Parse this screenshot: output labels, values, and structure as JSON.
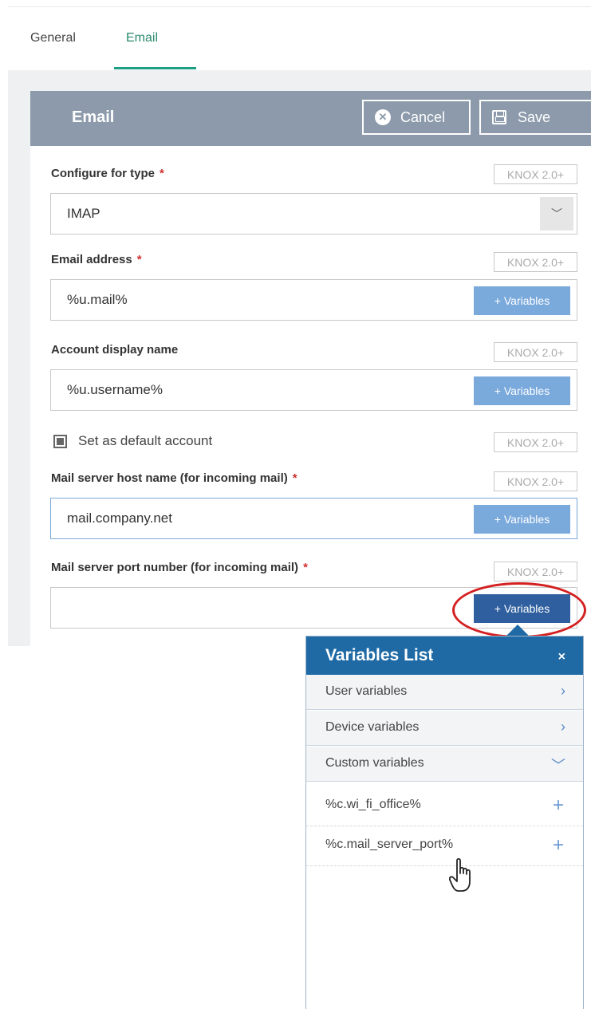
{
  "tabs": {
    "general": "General",
    "email": "Email"
  },
  "header": {
    "title": "Email",
    "cancel": "Cancel",
    "save": "Save"
  },
  "knox_badge": "KNOX 2.0+",
  "fields": {
    "configure_type": {
      "label": "Configure for type",
      "value": "IMAP"
    },
    "email_address": {
      "label": "Email address",
      "value": "%u.mail%"
    },
    "display_name": {
      "label": "Account display name",
      "value": "%u.username%"
    },
    "default_account": {
      "label": "Set as default account",
      "checked": true
    },
    "host_name": {
      "label": "Mail server host name (for incoming mail)",
      "value": "mail.company.net"
    },
    "port_number": {
      "label": "Mail server port number (for incoming mail)",
      "value": ""
    }
  },
  "required_mark": "*",
  "variables_button": "+ Variables",
  "variables_popup": {
    "title": "Variables List",
    "close": "×",
    "groups": [
      {
        "label": "User variables",
        "icon": "chevron-right-icon"
      },
      {
        "label": "Device variables",
        "icon": "chevron-right-icon"
      },
      {
        "label": "Custom variables",
        "icon": "chevron-down-icon"
      }
    ],
    "items": [
      {
        "label": "%c.wi_fi_office%"
      },
      {
        "label": "%c.mail_server_port%"
      }
    ]
  }
}
